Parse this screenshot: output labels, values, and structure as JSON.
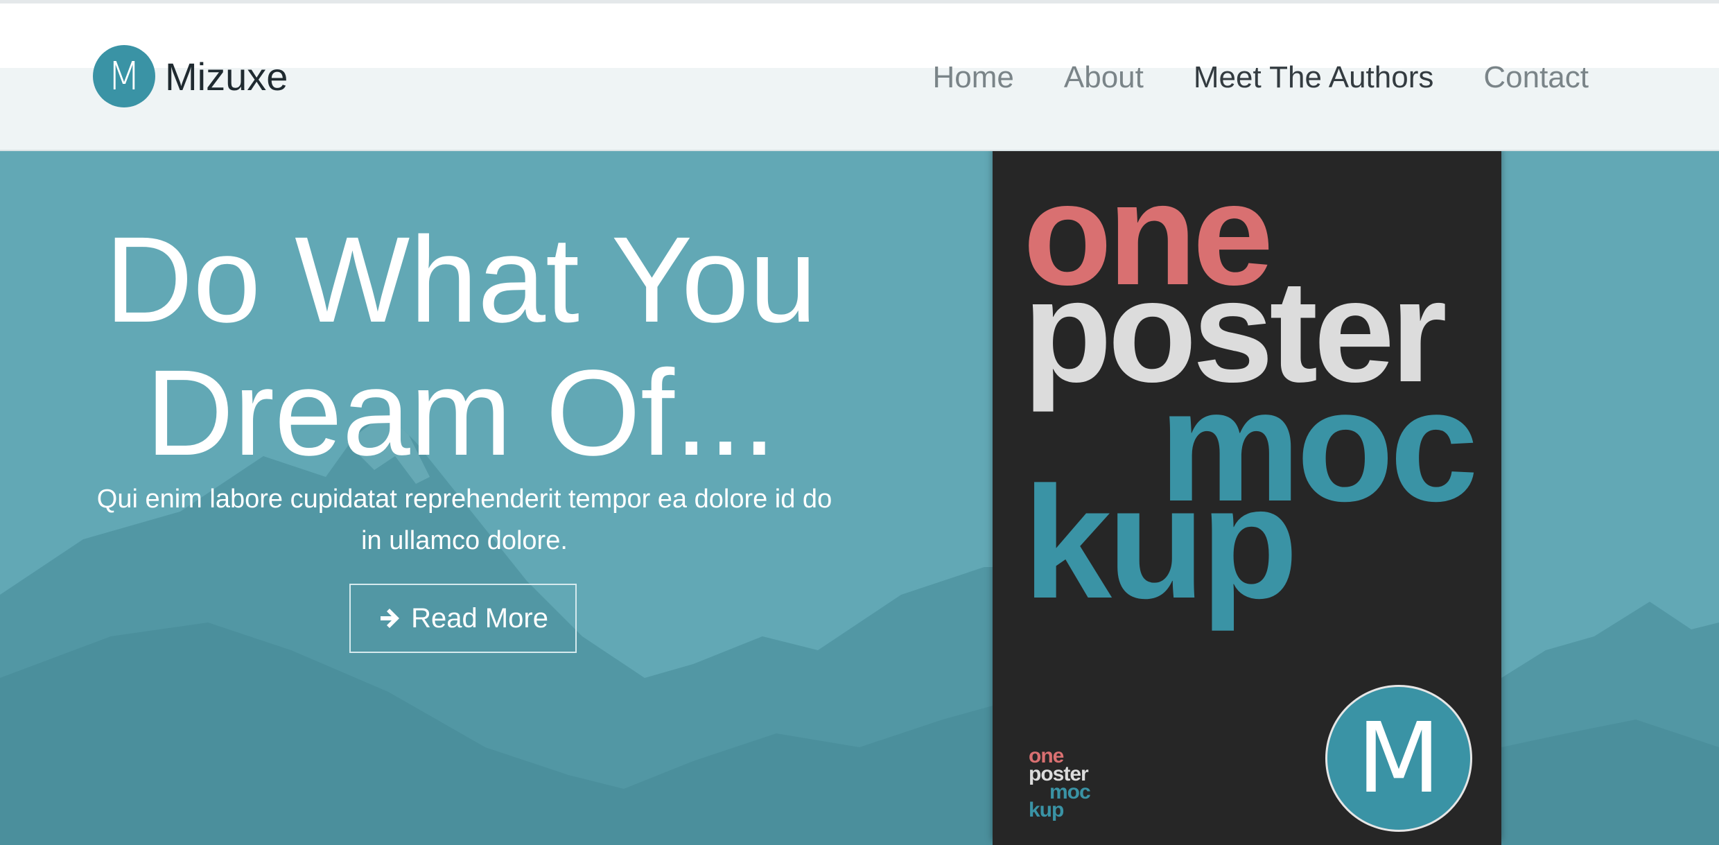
{
  "brand": {
    "logo_letter": "M",
    "name": "Mizuxe"
  },
  "nav": {
    "items": [
      {
        "label": "Home"
      },
      {
        "label": "About"
      },
      {
        "label": "Meet The Authors"
      },
      {
        "label": "Contact"
      }
    ]
  },
  "hero": {
    "title_line1": "Do What You",
    "title_line2": "Dream Of...",
    "subtitle": "Qui enim labore cupidatat reprehenderit tempor ea dolore id do in ullamco dolore.",
    "button_label": "Read More",
    "button_icon": "arrow-right-icon"
  },
  "poster": {
    "word1": "one",
    "word2": "poster",
    "word3": "moc",
    "word4": "kup",
    "badge_letter": "M"
  },
  "colors": {
    "accent": "#3a93a5",
    "hero_bg": "#62a8b5",
    "poster_bg": "#262626",
    "poster_pink": "#d97071"
  }
}
